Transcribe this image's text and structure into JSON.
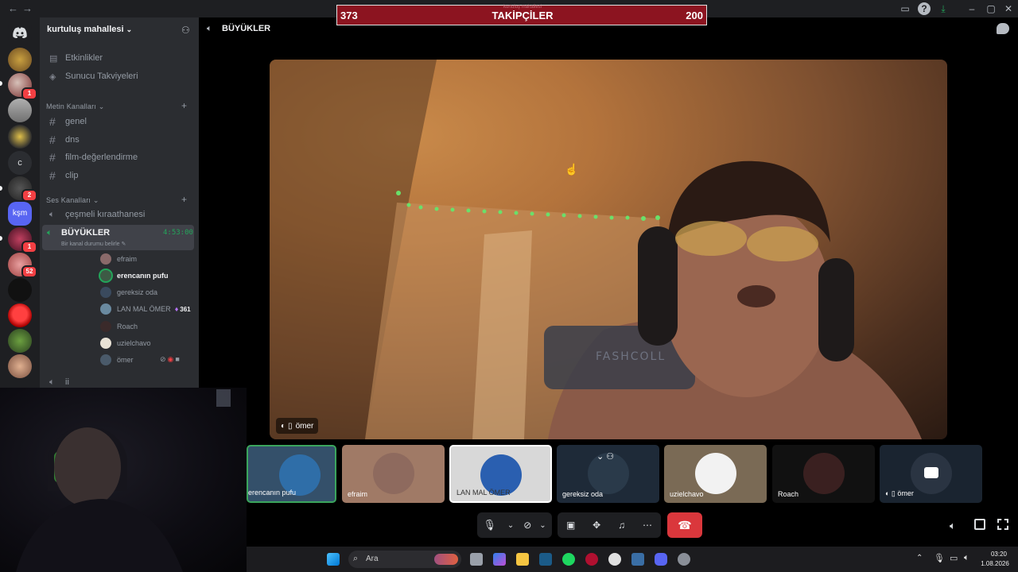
{
  "server": {
    "name": "kurtuluş mahallesi",
    "menu": [
      "Etkinlikler",
      "Sunucu Takviyeleri"
    ]
  },
  "text_category": "Metin Kanalları",
  "text_channels": [
    "genel",
    "dns",
    "film-değerlendirme",
    "clip"
  ],
  "voice_category": "Ses Kanalları",
  "voice_channels": {
    "first": "çeşmeli kıraathanesi",
    "active": "BÜYÜKLER",
    "active_timer": "4:53:00",
    "status_hint": "Bir kanal durumu belirle",
    "last": "ii"
  },
  "voice_users": [
    {
      "name": "efraim",
      "color": "#8a6a6a"
    },
    {
      "name": "erencanın pufu",
      "color": "#3d5a45",
      "speaking": true
    },
    {
      "name": "gereksiz oda",
      "color": "#3a4a5e"
    },
    {
      "name": "LAN MAL ÖMER",
      "color": "#6a8aa0",
      "boost": "361"
    },
    {
      "name": "Roach",
      "color": "#3a2a2a"
    },
    {
      "name": "uzielchavo",
      "color": "#e9e2d6"
    },
    {
      "name": "ömer",
      "color": "#4a5a6a"
    }
  ],
  "server_badges": [
    "1",
    "2",
    "1",
    "52"
  ],
  "server_label_c": "c",
  "server_label_ksm": "kşm",
  "header": {
    "channel": "BÜYÜKLER"
  },
  "overlay": {
    "left": "373",
    "title": "TAKİPÇİLER",
    "right": "200",
    "faded": "kurtuluş mahallesi"
  },
  "stage": {
    "label": "ömer",
    "shirt_text": "FASHCOLL"
  },
  "tiles": [
    {
      "name": "erencanın pufu",
      "bg": "#34506a",
      "ava": "#2f6ea8",
      "border": "#3ba55d"
    },
    {
      "name": "efraim",
      "bg": "#a07a66",
      "ava": "#8e6a5e"
    },
    {
      "name": "LAN MAL ÖMER",
      "bg": "#d8d8d8",
      "ava": "#2a5fb0",
      "border": "#ffffff"
    },
    {
      "name": "gereksiz oda",
      "bg": "#1e2a38",
      "ava": "#2a3a4a"
    },
    {
      "name": "uzielchavo",
      "bg": "#7a6a55",
      "ava": "#f2f2f2"
    },
    {
      "name": "Roach",
      "bg": "#111111",
      "ava": "#3a2020"
    },
    {
      "name": "ömer",
      "bg": "#1a2430",
      "ava": "#2a3442"
    }
  ],
  "taskbar": {
    "search": "Ara",
    "time": "03:20",
    "date": "1.08.2026"
  }
}
